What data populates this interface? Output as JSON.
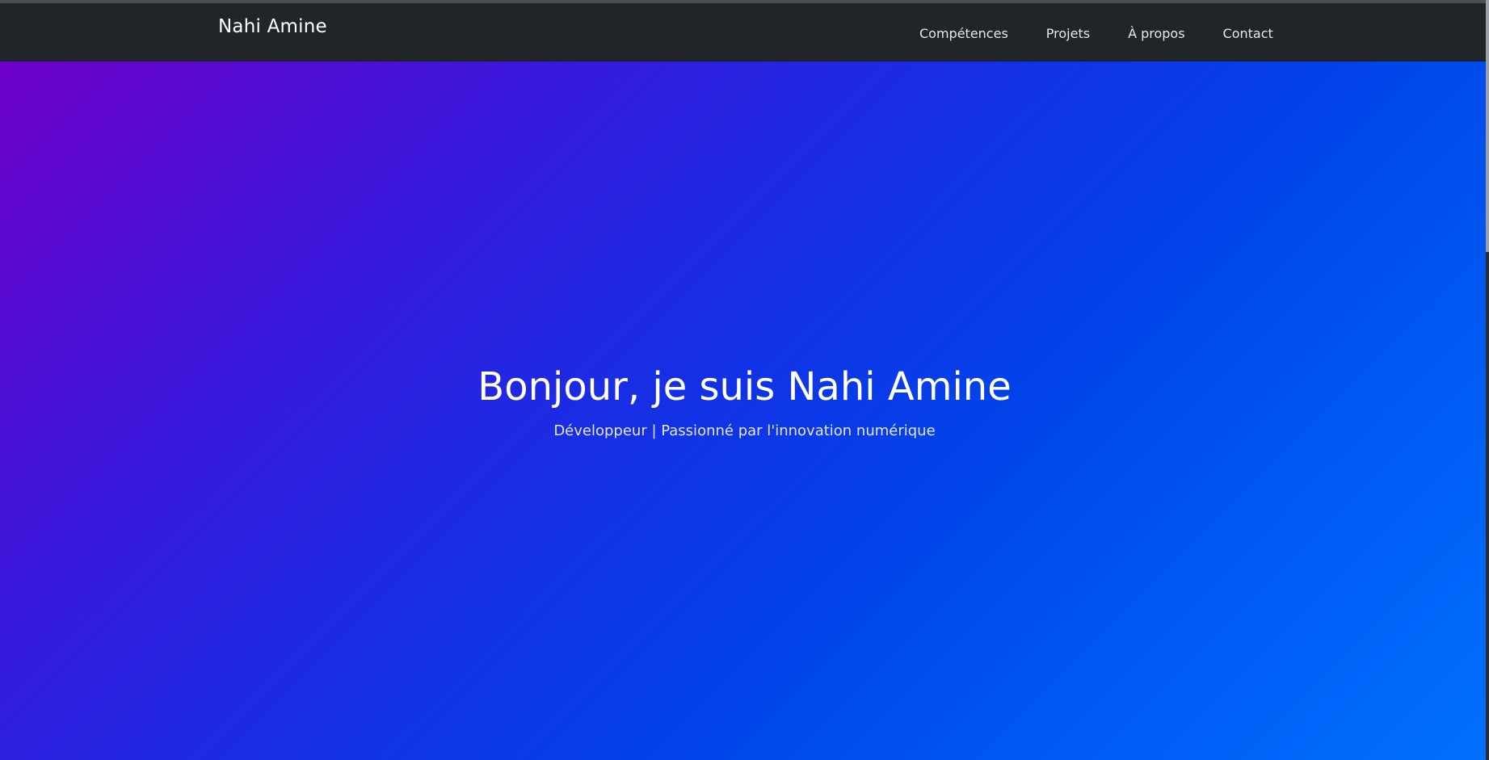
{
  "navbar": {
    "brand": "Nahi Amine",
    "links": [
      {
        "label": "Compétences"
      },
      {
        "label": "Projets"
      },
      {
        "label": "À propos"
      },
      {
        "label": "Contact"
      }
    ]
  },
  "hero": {
    "title": "Bonjour, je suis Nahi Amine",
    "subtitle": "Développeur | Passionné par l'innovation numérique"
  },
  "colors": {
    "navbar_background": "#212529",
    "gradient_start": "#6e00c9",
    "gradient_end": "#0070ff",
    "text_primary": "#ffffff"
  }
}
